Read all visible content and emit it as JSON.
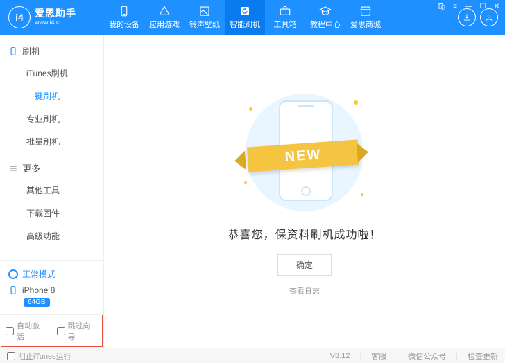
{
  "brand": {
    "name": "爱思助手",
    "url": "www.i4.cn",
    "logo": "i4"
  },
  "nav": [
    {
      "label": "我的设备"
    },
    {
      "label": "应用游戏"
    },
    {
      "label": "铃声壁纸"
    },
    {
      "label": "智能刷机"
    },
    {
      "label": "工具箱"
    },
    {
      "label": "教程中心"
    },
    {
      "label": "爱思商城"
    }
  ],
  "nav_active_index": 3,
  "sidebar": {
    "sections": [
      {
        "title": "刷机",
        "icon": "phone",
        "items": [
          "iTunes刷机",
          "一键刷机",
          "专业刷机",
          "批量刷机"
        ],
        "active_index": 1
      },
      {
        "title": "更多",
        "icon": "menu",
        "items": [
          "其他工具",
          "下载固件",
          "高级功能"
        ],
        "active_index": -1
      }
    ],
    "mode": "正常模式",
    "device": {
      "name": "iPhone 8",
      "storage": "64GB"
    },
    "options": [
      {
        "label": "自动激活",
        "checked": false
      },
      {
        "label": "跳过向导",
        "checked": false
      }
    ]
  },
  "main": {
    "ribbon_text": "NEW",
    "success_text": "恭喜您，保资料刷机成功啦！",
    "confirm_label": "确定",
    "log_link": "查看日志"
  },
  "footer": {
    "block_itunes": "阻止iTunes运行",
    "version": "V8.12",
    "links": [
      "客服",
      "微信公众号",
      "检查更新"
    ]
  }
}
